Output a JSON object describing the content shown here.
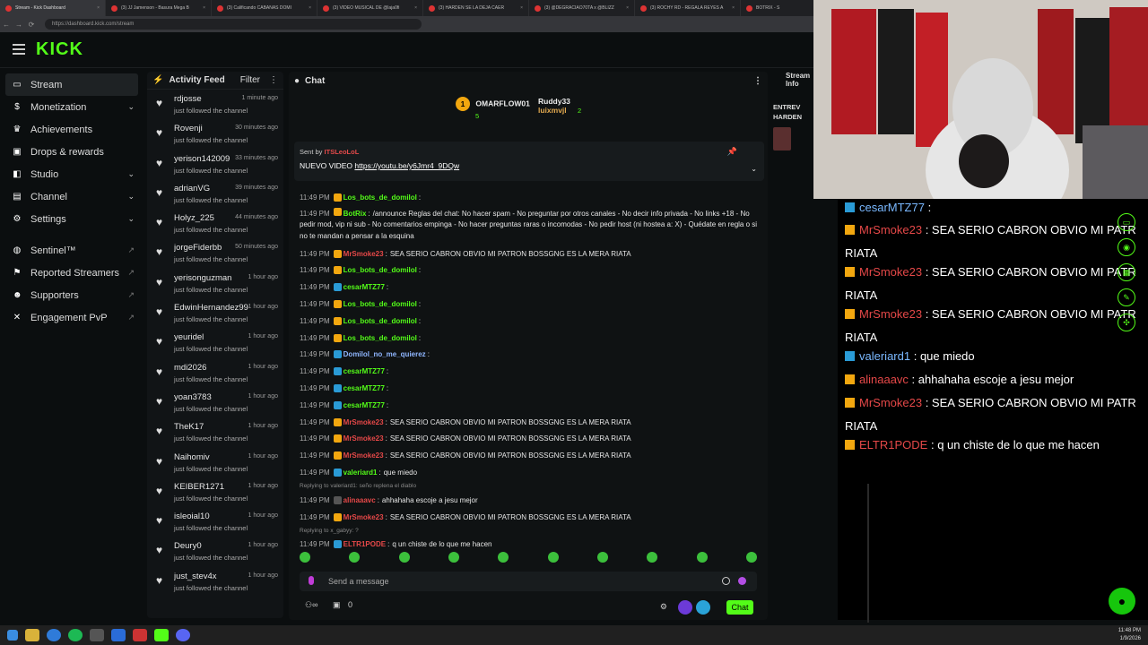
{
  "browser": {
    "tabs": [
      {
        "title": "Stream - Kick Dashboard",
        "active": true
      },
      {
        "title": "(3) JJ Jamenson - Basura Mega B"
      },
      {
        "title": "(3) Calificando CABAÑAS DOMI"
      },
      {
        "title": "(3) VIDEO MUSICAL DE @laja0fi"
      },
      {
        "title": "(3) HARDEN SE LA DEJA CAER"
      },
      {
        "title": "(3) @DEGRACIAO70TA x @BLIZZ"
      },
      {
        "title": "(3) ROCHY RD - REGALA REYES A"
      },
      {
        "title": "BOTRIX - S"
      }
    ],
    "url": "https://dashboard.kick.com/stream"
  },
  "brand": {
    "logo": "KICK",
    "accent": "#53fc18"
  },
  "sidebar": [
    {
      "label": "Stream",
      "icon": "stream-icon",
      "active": true
    },
    {
      "label": "Monetization",
      "icon": "dollar-icon",
      "chevron": true
    },
    {
      "label": "Achievements",
      "icon": "trophy-icon"
    },
    {
      "label": "Drops & rewards",
      "icon": "gift-icon"
    },
    {
      "label": "Studio",
      "icon": "studio-icon",
      "chevron": true
    },
    {
      "label": "Channel",
      "icon": "channel-icon",
      "chevron": true
    },
    {
      "label": "Settings",
      "icon": "gear-icon",
      "chevron": true
    },
    {
      "label": "Sentinel™",
      "icon": "shield-icon",
      "ext": true
    },
    {
      "label": "Reported Streamers",
      "icon": "flag-icon",
      "ext": true
    },
    {
      "label": "Supporters",
      "icon": "users-icon",
      "ext": true
    },
    {
      "label": "Engagement PvP",
      "icon": "swords-icon",
      "ext": true
    }
  ],
  "feed": {
    "title": "Activity Feed",
    "filter": "Filter",
    "items": [
      {
        "name": "rdjosse",
        "time": "1 minute ago",
        "sub": "just followed the channel"
      },
      {
        "name": "Rovenji",
        "time": "30 minutes ago",
        "sub": "just followed the channel"
      },
      {
        "name": "yerison142009",
        "time": "33 minutes ago",
        "sub": "just followed the channel"
      },
      {
        "name": "adrianVG",
        "time": "39 minutes ago",
        "sub": "just followed the channel"
      },
      {
        "name": "Holyz_225",
        "time": "44 minutes ago",
        "sub": "just followed the channel"
      },
      {
        "name": "jorgeFiderbb",
        "time": "50 minutes ago",
        "sub": "just followed the channel"
      },
      {
        "name": "yerisonguzman",
        "time": "1 hour ago",
        "sub": "just followed the channel"
      },
      {
        "name": "EdwinHernandez99",
        "time": "1 hour ago",
        "sub": "just followed the channel"
      },
      {
        "name": "yeuridel",
        "time": "1 hour ago",
        "sub": "just followed the channel"
      },
      {
        "name": "mdi2026",
        "time": "1 hour ago",
        "sub": "just followed the channel"
      },
      {
        "name": "yoan3783",
        "time": "1 hour ago",
        "sub": "just followed the channel"
      },
      {
        "name": "TheK17",
        "time": "1 hour ago",
        "sub": "just followed the channel"
      },
      {
        "name": "Naihomiv",
        "time": "1 hour ago",
        "sub": "just followed the channel"
      },
      {
        "name": "KEIBER1271",
        "time": "1 hour ago",
        "sub": "just followed the channel"
      },
      {
        "name": "isleoial10",
        "time": "1 hour ago",
        "sub": "just followed the channel"
      },
      {
        "name": "Deury0",
        "time": "1 hour ago",
        "sub": "just followed the channel"
      },
      {
        "name": "just_stev4x",
        "time": "1 hour ago",
        "sub": "just followed the channel"
      }
    ]
  },
  "chat": {
    "title": "Chat",
    "leaders": [
      {
        "rank": "1",
        "name": "OMARFLOW01",
        "count": "5"
      },
      {
        "name": "Ruddy33",
        "count": ""
      },
      {
        "name": "luixmvjl",
        "count": "2"
      }
    ],
    "pinned": {
      "by_label": "Sent by",
      "by_user": "ITSLeoLoL",
      "text": "NUEVO VIDEO",
      "link": "https://youtu.be/y6Jmr4_9DQw"
    },
    "messages": [
      {
        "time": "11:49 PM",
        "user": "Los_bots_de_domilol",
        "color": "#53fc18",
        "text": "",
        "badge": "#f2a70f"
      },
      {
        "time": "11:49 PM",
        "user": "BotRix",
        "color": "#53fc18",
        "text": "/announce Reglas del chat: No hacer spam - No preguntar por otros canales - No decir info privada - No links +18 - No pedir mod, vip ni sub - No comentarios empinga - No hacer preguntas raras o incomodas - No pedir host (ni hostea a: X) - Quédate en regla o si no te mandan a pensar a la esquina",
        "badge": "#f2a70f",
        "two": true
      },
      {
        "time": "11:49 PM",
        "user": "MrSmoke23",
        "color": "#e54848",
        "text": "SEA SERIO CABRON OBVIO MI PATRON BOSSGNG ES LA MERA RIATA",
        "badge": "#f2a70f"
      },
      {
        "time": "11:49 PM",
        "user": "Los_bots_de_domilol",
        "color": "#53fc18",
        "text": "",
        "badge": "#f2a70f"
      },
      {
        "time": "11:49 PM",
        "user": "cesarMTZ77",
        "color": "#53fc18",
        "text": "",
        "badge": "#2a9bd6"
      },
      {
        "time": "11:49 PM",
        "user": "Los_bots_de_domilol",
        "color": "#53fc18",
        "text": "",
        "badge": "#f2a70f"
      },
      {
        "time": "11:49 PM",
        "user": "Los_bots_de_domilol",
        "color": "#53fc18",
        "text": "",
        "badge": "#f2a70f"
      },
      {
        "time": "11:49 PM",
        "user": "Los_bots_de_domilol",
        "color": "#53fc18",
        "text": "",
        "badge": "#f2a70f"
      },
      {
        "time": "11:49 PM",
        "user": "Domilol_no_me_quierez",
        "color": "#8fb6ff",
        "text": "",
        "badge": "#2a9bd6"
      },
      {
        "time": "11:49 PM",
        "user": "cesarMTZ77",
        "color": "#53fc18",
        "text": "",
        "badge": "#2a9bd6"
      },
      {
        "time": "11:49 PM",
        "user": "cesarMTZ77",
        "color": "#53fc18",
        "text": "",
        "badge": "#2a9bd6"
      },
      {
        "time": "11:49 PM",
        "user": "cesarMTZ77",
        "color": "#53fc18",
        "text": "",
        "badge": "#2a9bd6"
      },
      {
        "time": "11:49 PM",
        "user": "MrSmoke23",
        "color": "#e54848",
        "text": "SEA SERIO CABRON OBVIO MI PATRON BOSSGNG ES LA MERA RIATA",
        "badge": "#f2a70f"
      },
      {
        "time": "11:49 PM",
        "user": "MrSmoke23",
        "color": "#e54848",
        "text": "SEA SERIO CABRON OBVIO MI PATRON BOSSGNG ES LA MERA RIATA",
        "badge": "#f2a70f"
      },
      {
        "time": "11:49 PM",
        "user": "MrSmoke23",
        "color": "#e54848",
        "text": "SEA SERIO CABRON OBVIO MI PATRON BOSSGNG ES LA MERA RIATA",
        "badge": "#f2a70f"
      },
      {
        "time": "11:49 PM",
        "user": "valeriard1",
        "color": "#53fc18",
        "text": "que miedo",
        "badge": "#2a9bd6"
      },
      {
        "reply": "Replying to valeriard1: seño replena el diablo"
      },
      {
        "time": "11:49 PM",
        "user": "alinaaavc",
        "color": "#e54848",
        "text": "ahhahaha escoje a jesu mejor",
        "badge": "#555"
      },
      {
        "time": "11:49 PM",
        "user": "MrSmoke23",
        "color": "#e54848",
        "text": "SEA SERIO CABRON OBVIO MI PATRON BOSSGNG ES LA MERA RIATA",
        "badge": "#f2a70f"
      },
      {
        "reply": "Replying to x_gabyy: ?"
      },
      {
        "time": "11:49 PM",
        "user": "ELTR1PODE",
        "color": "#e54848",
        "text": "q un chiste de lo que me hacen",
        "badge": "#2a9bd6"
      }
    ],
    "send_placeholder": "Send a message",
    "foot_count": "0",
    "chat_button": "Chat"
  },
  "stream_info": {
    "label": "Stream Info",
    "title_fragment": "ENTREV HARDEN"
  },
  "popout": [
    {
      "user": "cesarMTZ77",
      "color": "blue",
      "text": ""
    },
    {
      "user": "MrSmoke23",
      "color": "red",
      "text": "SEA SERIO CABRON OBVIO MI PATR",
      "cont": "RIATA"
    },
    {
      "user": "MrSmoke23",
      "color": "red",
      "text": "SEA SERIO CABRON OBVIO MI PATR",
      "cont": "RIATA"
    },
    {
      "user": "MrSmoke23",
      "color": "red",
      "text": "SEA SERIO CABRON OBVIO MI PATR",
      "cont": "RIATA"
    },
    {
      "user": "valeriard1",
      "color": "green",
      "text": "que miedo"
    },
    {
      "user": "alinaaavc",
      "color": "red",
      "text": "ahhahaha escoje a jesu mejor"
    },
    {
      "user": "MrSmoke23",
      "color": "red",
      "text": "SEA SERIO CABRON OBVIO MI PATR",
      "cont": "RIATA"
    },
    {
      "user": "ELTR1PODE",
      "color": "red",
      "text": "q un chiste de lo que me hacen"
    }
  ],
  "clock": {
    "time": "11:48 PM",
    "date": "1/9/2026"
  }
}
